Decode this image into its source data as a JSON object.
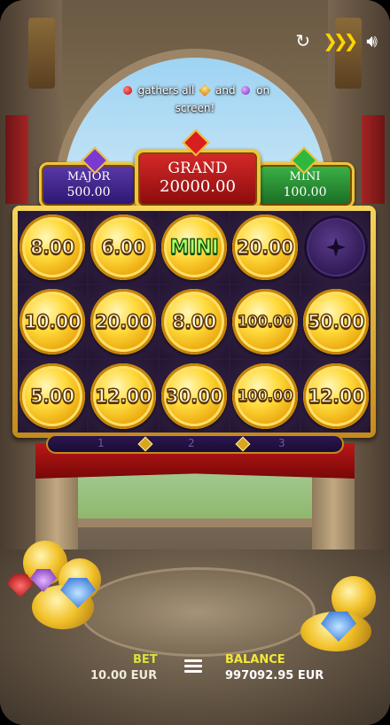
{
  "top_bar": {
    "icons": [
      "refresh-icon",
      "turbo-chevrons-icon",
      "sound-icon"
    ]
  },
  "info": {
    "part1": "gathers all",
    "part2": "and",
    "part3": "on",
    "part4": "screen!"
  },
  "jackpots": {
    "major": {
      "label": "MAJOR",
      "value": "500.00"
    },
    "grand": {
      "label": "GRAND",
      "value": "20000.00"
    },
    "mini": {
      "label": "MINI",
      "value": "100.00"
    }
  },
  "grid": [
    [
      "8.00",
      "6.00",
      "MINI",
      "20.00",
      ""
    ],
    [
      "10.00",
      "20.00",
      "8.00",
      "100.00",
      "50.00"
    ],
    [
      "5.00",
      "12.00",
      "30.00",
      "100.00",
      "12.00"
    ]
  ],
  "progress": {
    "steps": [
      "1",
      "2",
      "3"
    ],
    "current": 0
  },
  "bottom": {
    "bet_label": "BET",
    "bet_value": "10.00 EUR",
    "balance_label": "BALANCE",
    "balance_value": "997092.95 EUR"
  },
  "colors": {
    "accent_gold": "#f0c43a",
    "grand_red": "#d62a2a",
    "major_purple": "#5b3aa8",
    "mini_green": "#3bb347",
    "balance_label": "#f4e93a"
  }
}
